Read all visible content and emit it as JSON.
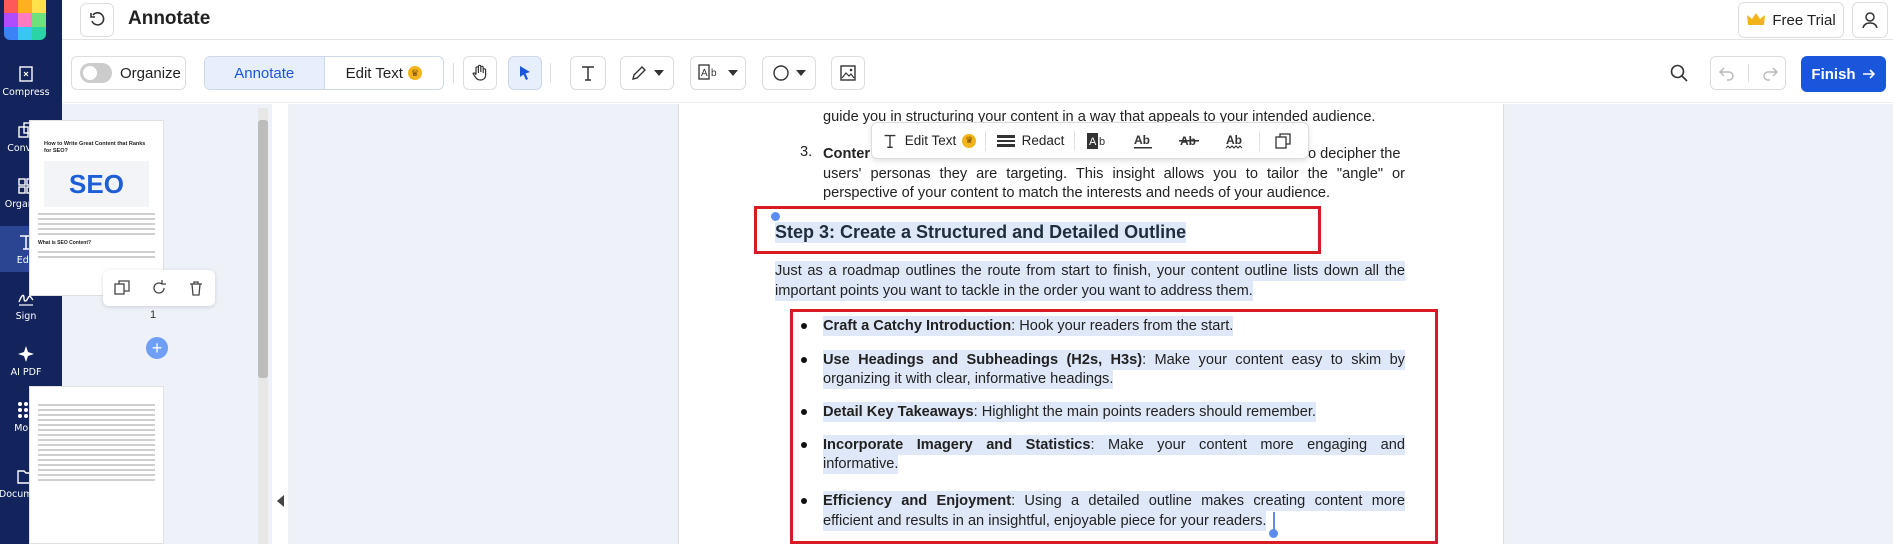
{
  "rail": {
    "items": [
      {
        "label": "Compress"
      },
      {
        "label": "Convert"
      },
      {
        "label": "Organize"
      },
      {
        "label": "Edit"
      },
      {
        "label": "Sign"
      },
      {
        "label": "AI PDF"
      },
      {
        "label": "More"
      },
      {
        "label": "Documents"
      }
    ]
  },
  "header": {
    "title": "Annotate",
    "free_trial": "Free Trial"
  },
  "toolbar": {
    "organize_label": "Organize",
    "tab_annotate": "Annotate",
    "tab_edit_text": "Edit Text",
    "finish_label": "Finish"
  },
  "sidebar": {
    "page_number": "1",
    "add_symbol": "+"
  },
  "float_toolbar": {
    "edit_text": "Edit Text",
    "redact": "Redact"
  },
  "document": {
    "line_guide": "guide you in structuring your content in a way that appeals to your intended audience.",
    "item3_num": "3.",
    "item3_lead": "Conter",
    "item3_tail": "o decipher the",
    "item3_line2": "users' personas they are targeting. This insight allows you to tailor the \"angle\" or",
    "item3_line3": "perspective of your content to match the interests and needs of your audience.",
    "heading": "Step 3: Create a Structured and Detailed Outline",
    "intro_line1": "Just as a roadmap outlines the route from start to finish, your content outline lists down all the",
    "intro_line2": "important points you want to tackle in the order you want to address them.",
    "bullets": [
      {
        "bold": "Craft a Catchy Introduction",
        "text": ": Hook your readers from the start.",
        "line2": ""
      },
      {
        "bold": "Use Headings and Subheadings (H2s, H3s)",
        "text": ": Make your content easy to skim by",
        "line2": "organizing it with clear, informative headings."
      },
      {
        "bold": "Detail Key Takeaways",
        "text": ": Highlight the main points readers should remember.",
        "line2": ""
      },
      {
        "bold": "Incorporate Imagery and Statistics",
        "text": ": Make your content more engaging and",
        "line2": "informative."
      },
      {
        "bold": "Efficiency and Enjoyment",
        "text": ": Using a detailed outline makes creating content more",
        "line2": "efficient and results in an insightful, enjoyable piece for your readers."
      }
    ]
  },
  "thumbnail": {
    "title": "How to Write Great Content that Ranks for SEO?",
    "image_text": "SEO",
    "section": "What is SEO Content?"
  }
}
